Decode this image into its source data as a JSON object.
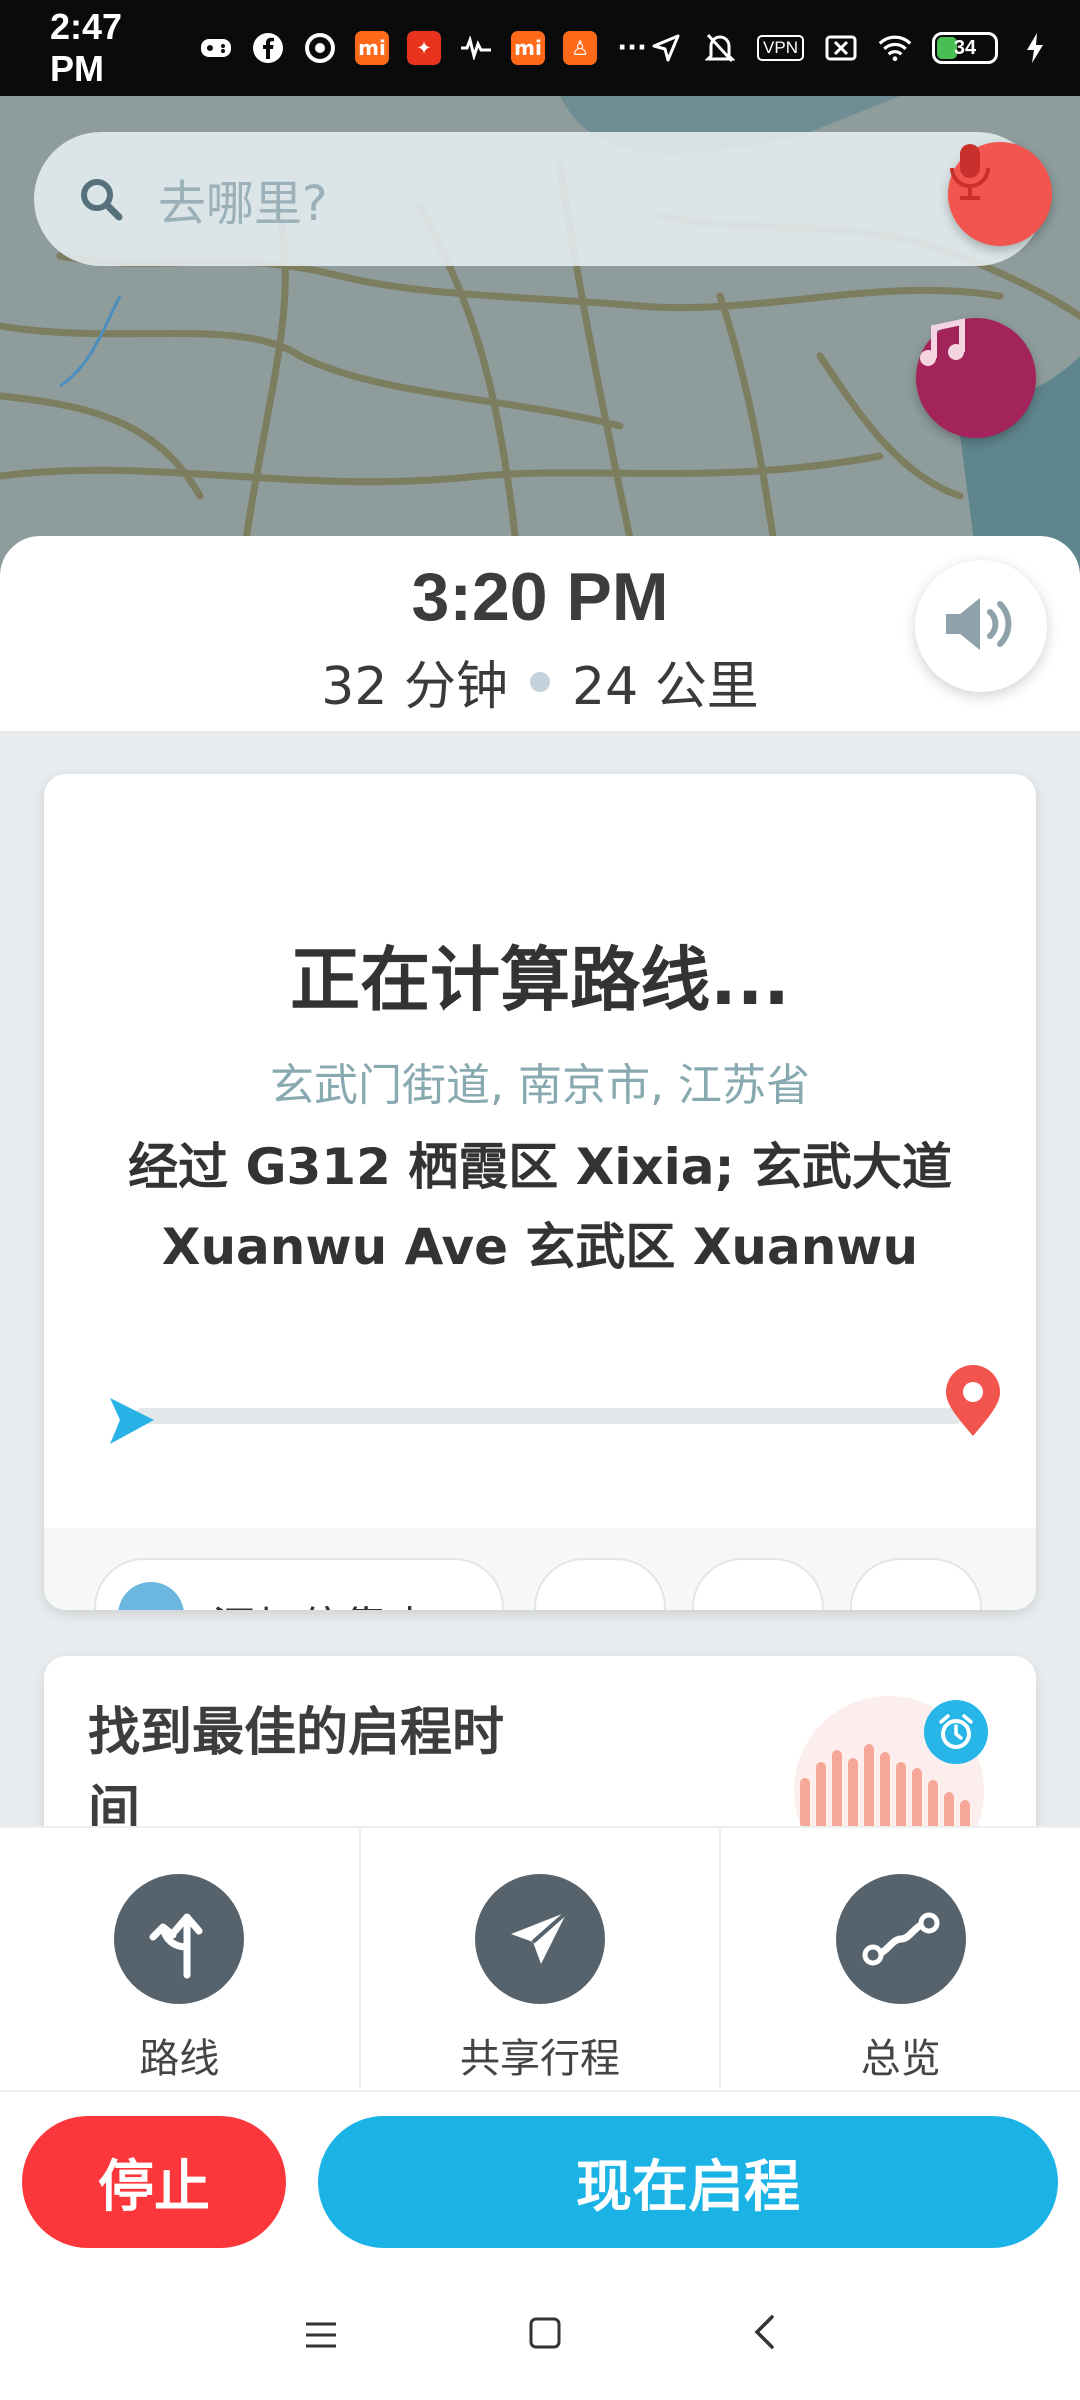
{
  "status_bar": {
    "time": "2:47 PM",
    "vpn_label": "VPN",
    "battery": "34",
    "more": "···"
  },
  "search": {
    "placeholder": "去哪里?"
  },
  "eta": {
    "arrival_time": "3:20 PM",
    "duration": "32 分钟",
    "distance": "24 公里"
  },
  "route_card": {
    "title": "正在计算路线...",
    "address": "玄武门街道, 南京市, 江苏省",
    "via": "经过 G312 栖霞区 Xixia; 玄武大道 Xuanwu Ave 玄武区 Xuanwu",
    "add_stop_label": "添加停靠点"
  },
  "depart_card": {
    "title": "找到最佳的启程时间"
  },
  "actions": [
    {
      "label": "路线",
      "icon": "route-fork-icon"
    },
    {
      "label": "共享行程",
      "icon": "send-icon"
    },
    {
      "label": "总览",
      "icon": "overview-icon"
    }
  ],
  "buttons": {
    "stop": "停止",
    "go": "现在启程"
  },
  "colors": {
    "stop": "#fb373c",
    "go": "#1bb3e6",
    "mic": "#f2544e",
    "music": "#a3245a"
  }
}
